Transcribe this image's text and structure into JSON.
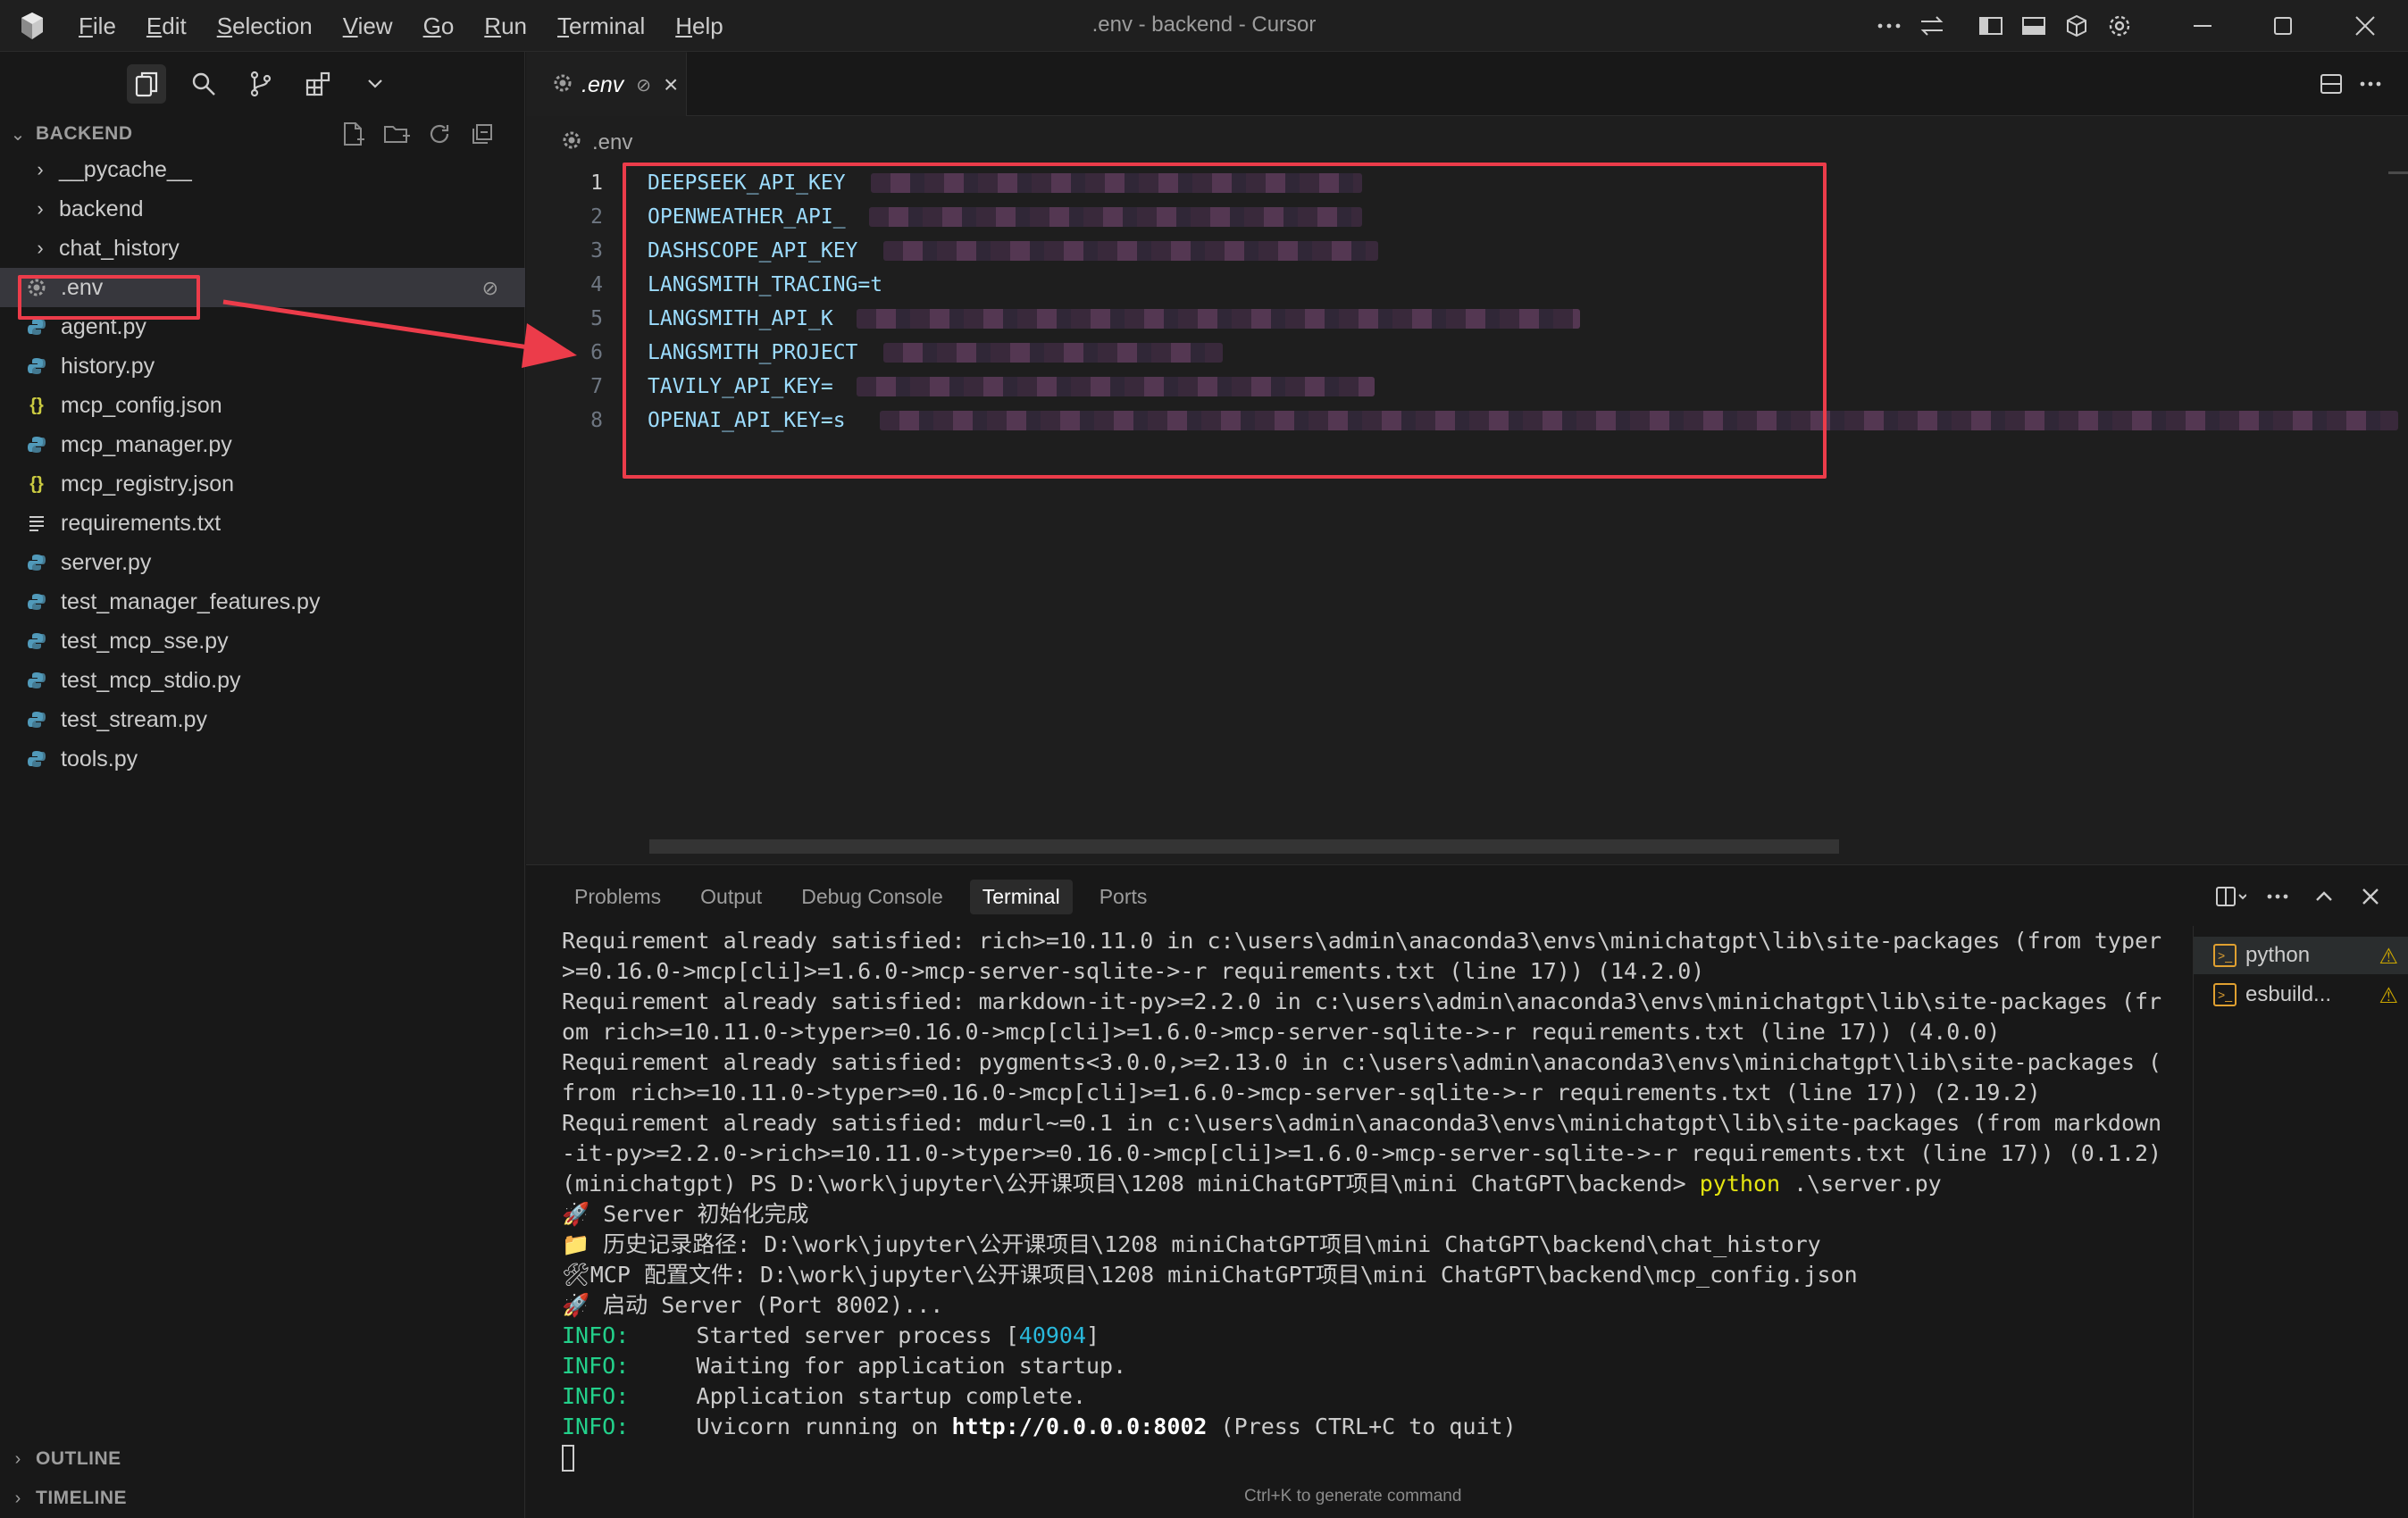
{
  "window": {
    "title": ".env - backend - Cursor",
    "menu": [
      "File",
      "Edit",
      "Selection",
      "View",
      "Go",
      "Run",
      "Terminal",
      "Help"
    ]
  },
  "explorer": {
    "section_title": "BACKEND",
    "items": [
      {
        "label": "__pycache__",
        "type": "folder",
        "icon": "chevron-right-icon"
      },
      {
        "label": "backend",
        "type": "folder",
        "icon": "chevron-right-icon"
      },
      {
        "label": "chat_history",
        "type": "folder",
        "icon": "chevron-right-icon"
      },
      {
        "label": ".env",
        "type": "env",
        "icon": "gear-icon",
        "selected": true
      },
      {
        "label": "agent.py",
        "type": "python",
        "icon": "python-icon"
      },
      {
        "label": "history.py",
        "type": "python",
        "icon": "python-icon"
      },
      {
        "label": "mcp_config.json",
        "type": "json",
        "icon": "json-icon"
      },
      {
        "label": "mcp_manager.py",
        "type": "python",
        "icon": "python-icon"
      },
      {
        "label": "mcp_registry.json",
        "type": "json",
        "icon": "json-icon"
      },
      {
        "label": "requirements.txt",
        "type": "text",
        "icon": "text-lines-icon"
      },
      {
        "label": "server.py",
        "type": "python",
        "icon": "python-icon"
      },
      {
        "label": "test_manager_features.py",
        "type": "python",
        "icon": "python-icon"
      },
      {
        "label": "test_mcp_sse.py",
        "type": "python",
        "icon": "python-icon"
      },
      {
        "label": "test_mcp_stdio.py",
        "type": "python",
        "icon": "python-icon"
      },
      {
        "label": "test_stream.py",
        "type": "python",
        "icon": "python-icon"
      },
      {
        "label": "tools.py",
        "type": "python",
        "icon": "python-icon"
      }
    ],
    "outline_label": "OUTLINE",
    "timeline_label": "TIMELINE"
  },
  "editor": {
    "tab_label": ".env",
    "breadcrumb": ".env",
    "lines": [
      {
        "n": "1",
        "text": "DEEPSEEK_API_KEY"
      },
      {
        "n": "2",
        "text": "OPENWEATHER_API_"
      },
      {
        "n": "3",
        "text": "DASHSCOPE_API_KEY"
      },
      {
        "n": "4",
        "text": "LANGSMITH_TRACING=t"
      },
      {
        "n": "5",
        "text": "LANGSMITH_API_K"
      },
      {
        "n": "6",
        "text": "LANGSMITH_PROJECT"
      },
      {
        "n": "7",
        "text": "TAVILY_API_KEY="
      },
      {
        "n": "8",
        "text": "OPENAI_API_KEY=s"
      }
    ]
  },
  "panel": {
    "tabs": [
      "Problems",
      "Output",
      "Debug Console",
      "Terminal",
      "Ports"
    ],
    "active_tab": "Terminal",
    "terminal_lines": [
      "Requirement already satisfied: rich>=10.11.0 in c:\\users\\admin\\anaconda3\\envs\\minichatgpt\\lib\\site-packages (from typer",
      ">=0.16.0->mcp[cli]>=1.6.0->mcp-server-sqlite->-r requirements.txt (line 17)) (14.2.0)",
      "Requirement already satisfied: markdown-it-py>=2.2.0 in c:\\users\\admin\\anaconda3\\envs\\minichatgpt\\lib\\site-packages (fr",
      "om rich>=10.11.0->typer>=0.16.0->mcp[cli]>=1.6.0->mcp-server-sqlite->-r requirements.txt (line 17)) (4.0.0)",
      "Requirement already satisfied: pygments<3.0.0,>=2.13.0 in c:\\users\\admin\\anaconda3\\envs\\minichatgpt\\lib\\site-packages (",
      "from rich>=10.11.0->typer>=0.16.0->mcp[cli]>=1.6.0->mcp-server-sqlite->-r requirements.txt (line 17)) (2.19.2)",
      "Requirement already satisfied: mdurl~=0.1 in c:\\users\\admin\\anaconda3\\envs\\minichatgpt\\lib\\site-packages (from markdown",
      "-it-py>=2.2.0->rich>=10.11.0->typer>=0.16.0->mcp[cli]>=1.6.0->mcp-server-sqlite->-r requirements.txt (line 17)) (0.1.2)"
    ],
    "prompt": "(minichatgpt) PS D:\\work\\jupyter\\公开课项目\\1208 miniChatGPT项目\\mini ChatGPT\\backend> ",
    "command_name": "python",
    "command_args": " .\\server.py",
    "server_lines": [
      "🚀 Server 初始化完成",
      "📁 历史记录路径: D:\\work\\jupyter\\公开课项目\\1208 miniChatGPT项目\\mini ChatGPT\\backend\\chat_history",
      "🛠MCP 配置文件: D:\\work\\jupyter\\公开课项目\\1208 miniChatGPT项目\\mini ChatGPT\\backend\\mcp_config.json",
      "🚀 启动 Server (Port 8002)..."
    ],
    "info_label": "INFO:",
    "info1_pre": "     Started server process [",
    "info1_pid": "40904",
    "info1_post": "]",
    "info2": "     Waiting for application startup.",
    "info3": "     Application startup complete.",
    "info4_pre": "     Uvicorn running on ",
    "info4_url": "http://0.0.0.0:8002",
    "info4_post": " (Press CTRL+C to quit)",
    "terminals": [
      {
        "label": "python"
      },
      {
        "label": "esbuild..."
      }
    ],
    "hint": "Ctrl+K to generate command"
  },
  "colors": {
    "highlight_red": "#ec3c4a",
    "env_key": "#9cdcfe",
    "info_green": "#23d18b",
    "command_yellow": "#e5e510",
    "python_icon": "#519aba",
    "json_icon": "#cbcb41"
  }
}
